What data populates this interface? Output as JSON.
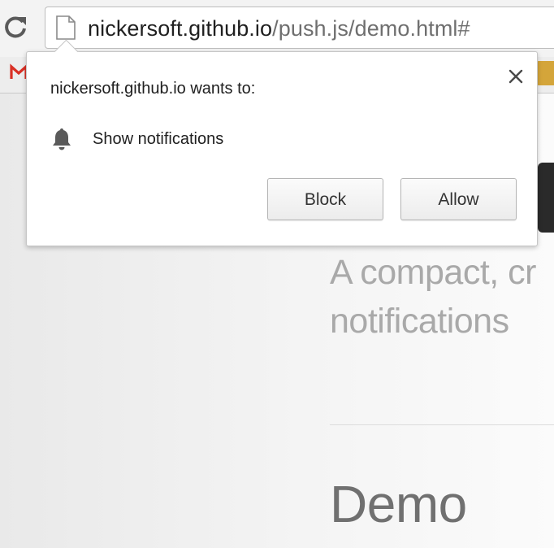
{
  "browser": {
    "address_bar": {
      "host": "nickersoft.github.io",
      "path": "/push.js/demo.html#"
    }
  },
  "page": {
    "tagline_line1": "A compact, cr",
    "tagline_line2": "notifications",
    "section_heading": "Demo"
  },
  "permission_prompt": {
    "title": "nickersoft.github.io wants to:",
    "permission_label": "Show notifications",
    "block_label": "Block",
    "allow_label": "Allow",
    "close_glyph": "×"
  },
  "colors": {
    "bubble_bg": "#ffffff",
    "tagline": "#a9a9a9",
    "heading": "#707070",
    "gmail_red": "#d93025"
  },
  "icons": {
    "reload": "reload-icon",
    "page": "page-icon",
    "bell": "bell-icon",
    "close": "close-icon",
    "gmail": "gmail-icon"
  }
}
